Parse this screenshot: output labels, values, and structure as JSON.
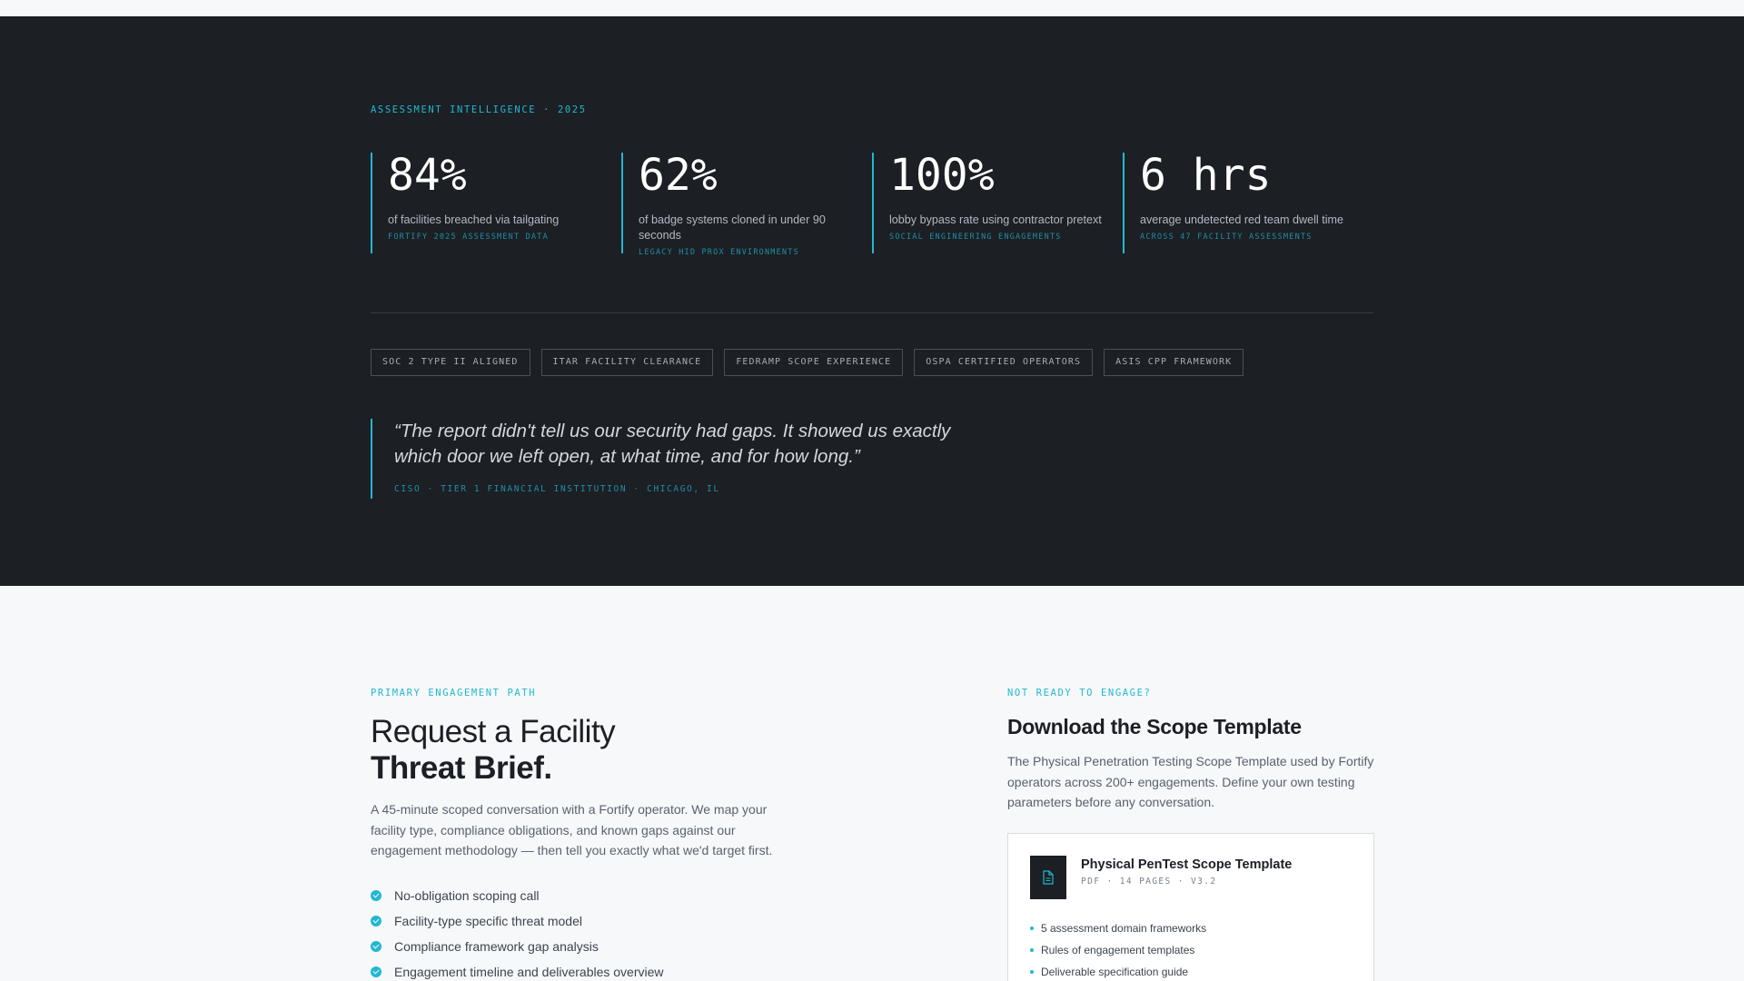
{
  "intel": {
    "eyebrow": "ASSESSMENT INTELLIGENCE · 2025",
    "stats": [
      {
        "value": "84%",
        "label": "of facilities breached via tailgating",
        "source": "FORTIFY 2025 ASSESSMENT DATA"
      },
      {
        "value": "62%",
        "label": "of badge systems cloned in under 90 seconds",
        "source": "LEGACY HID PROX ENVIRONMENTS"
      },
      {
        "value": "100%",
        "label": "lobby bypass rate using contractor pretext",
        "source": "SOCIAL ENGINEERING ENGAGEMENTS"
      },
      {
        "value": "6 hrs",
        "label": "average undetected red team dwell time",
        "source": "ACROSS 47 FACILITY ASSESSMENTS"
      }
    ],
    "badges": [
      "SOC 2 TYPE II ALIGNED",
      "ITAR FACILITY CLEARANCE",
      "FEDRAMP SCOPE EXPERIENCE",
      "OSPA CERTIFIED OPERATORS",
      "ASIS CPP FRAMEWORK"
    ],
    "quote": {
      "text": "“The report didn't tell us our security had gaps. It showed us exactly which door we left open, at what time, and for how long.”",
      "cite": "CISO · TIER 1 FINANCIAL INSTITUTION · CHICAGO, IL"
    }
  },
  "primary": {
    "eyebrow": "PRIMARY ENGAGEMENT PATH",
    "title_line1": "Request a Facility",
    "title_line2": "Threat Brief.",
    "description": "A 45-minute scoped conversation with a Fortify operator. We map your facility type, compliance obligations, and known gaps against our engagement methodology — then tell you exactly what we'd target first.",
    "checklist": [
      "No-obligation scoping call",
      "Facility-type specific threat model",
      "Compliance framework gap analysis",
      "Engagement timeline and deliverables overview"
    ]
  },
  "secondary": {
    "eyebrow": "NOT READY TO ENGAGE?",
    "title": "Download the Scope Template",
    "description": "The Physical Penetration Testing Scope Template used by Fortify operators across 200+ engagements. Define your own testing parameters before any conversation.",
    "card": {
      "title": "Physical PenTest Scope Template",
      "meta": "PDF · 14 PAGES · V3.2",
      "items": [
        "5 assessment domain frameworks",
        "Rules of engagement templates",
        "Deliverable specification guide"
      ]
    }
  },
  "colors": {
    "accent": "#22b8cf",
    "dark_bg": "#1c1f24",
    "light_bg": "#f6f8fa"
  }
}
